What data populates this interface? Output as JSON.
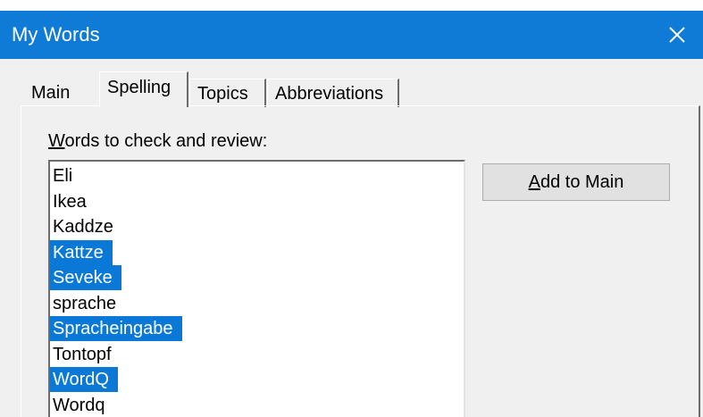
{
  "window": {
    "title": "My Words",
    "close_icon": "close-icon",
    "accent_color": "#0f7bd6"
  },
  "tabs": [
    {
      "label": "Main",
      "active": false
    },
    {
      "label": "Spelling",
      "active": true
    },
    {
      "label": "Topics",
      "active": false
    },
    {
      "label": "Abbreviations",
      "active": false
    }
  ],
  "spelling": {
    "list_label": "Words to check and review:",
    "words": [
      {
        "text": "Eli",
        "selected": false
      },
      {
        "text": "Ikea",
        "selected": false
      },
      {
        "text": "Kaddze",
        "selected": false
      },
      {
        "text": "Kattze",
        "selected": true
      },
      {
        "text": "Seveke",
        "selected": true
      },
      {
        "text": "sprache",
        "selected": false
      },
      {
        "text": "Spracheingabe",
        "selected": true
      },
      {
        "text": "Tontopf",
        "selected": false
      },
      {
        "text": "WordQ",
        "selected": true
      },
      {
        "text": "Wordq",
        "selected": false
      }
    ],
    "selection_color": "#0a78d7",
    "add_button_label": "Add to Main"
  }
}
